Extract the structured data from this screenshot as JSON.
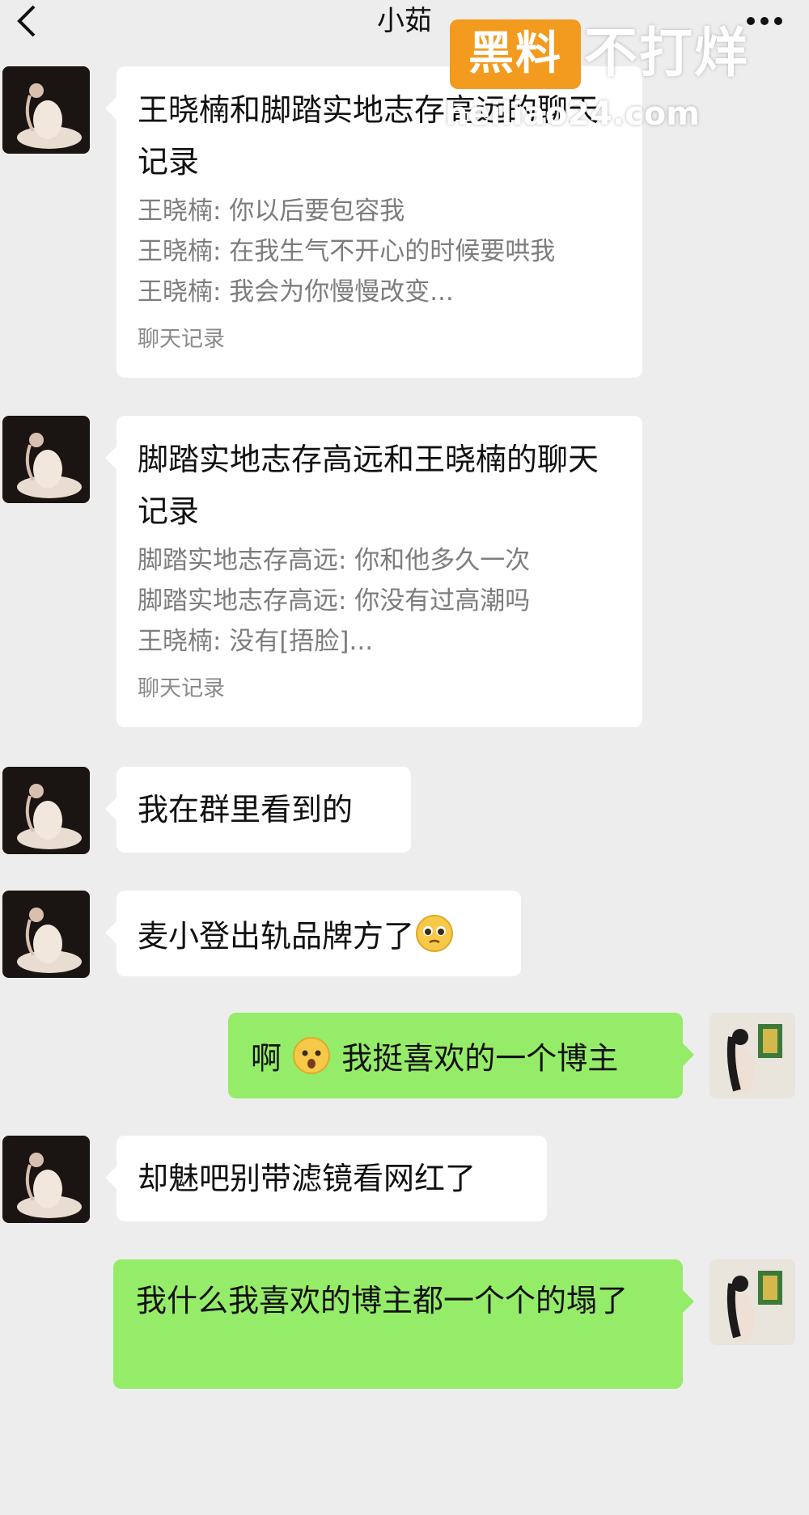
{
  "header": {
    "title": "小茹",
    "back_icon": "chevron-left-icon",
    "more_icon": "more-dots-icon"
  },
  "watermark": {
    "badge": "黑料",
    "text": "不打烊",
    "domain": "heiliao24.com",
    "badge_color": "#f39b1f"
  },
  "colors": {
    "background": "#ededed",
    "bubble_incoming": "#ffffff",
    "bubble_outgoing": "#95ec69"
  },
  "messages": [
    {
      "type": "chat_record",
      "title": "王晓楠和脚踏实地志存高远的聊天记录",
      "lines": [
        "王晓楠: 你以后要包容我",
        "王晓楠: 在我生气不开心的时候要哄我",
        "王晓楠: 我会为你慢慢改变..."
      ],
      "footer": "聊天记录"
    },
    {
      "type": "chat_record",
      "title": "脚踏实地志存高远和王晓楠的聊天记录",
      "lines": [
        "脚踏实地志存高远: 你和他多久一次",
        "脚踏实地志存高远: 你没有过高潮吗",
        "王晓楠: 没有[捂脸]..."
      ],
      "footer": "聊天记录"
    },
    {
      "type": "text",
      "text": "我在群里看到的"
    },
    {
      "type": "text",
      "text": "麦小登出轨品牌方了",
      "emoji": "pleading-face-emoji"
    },
    {
      "type": "text",
      "pre": "啊",
      "emoji": "worried-face-emoji",
      "text": "我挺喜欢的一个博主"
    },
    {
      "type": "text",
      "text": "却魅吧别带滤镜看网红了"
    },
    {
      "type": "text",
      "text": "我什么我喜欢的博主都一个个的塌了"
    }
  ]
}
